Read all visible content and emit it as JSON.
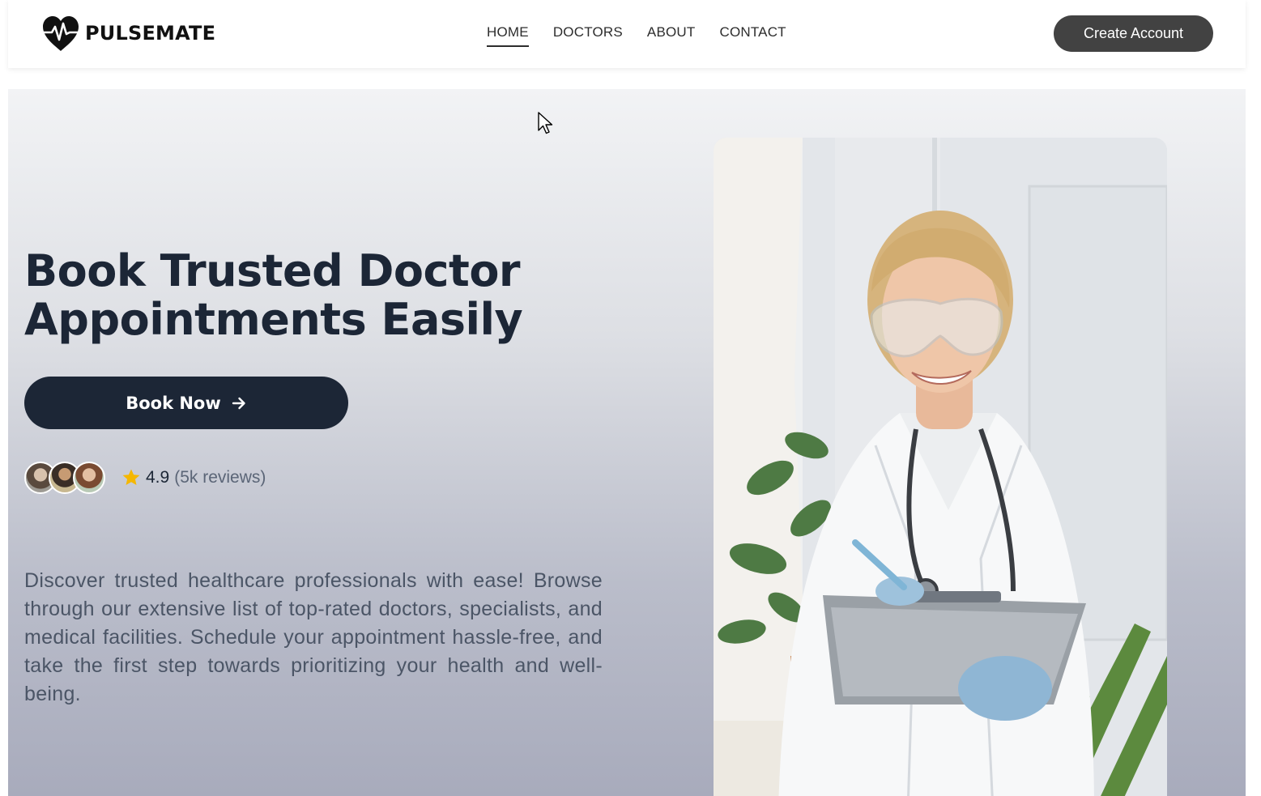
{
  "header": {
    "brand": "PULSEMATE",
    "nav": [
      {
        "label": "HOME",
        "active": true
      },
      {
        "label": "DOCTORS",
        "active": false
      },
      {
        "label": "ABOUT",
        "active": false
      },
      {
        "label": "CONTACT",
        "active": false
      }
    ],
    "create_account_label": "Create Account"
  },
  "hero": {
    "headline_line1": "Book Trusted Doctor",
    "headline_line2": "Appointments Easily",
    "book_button_label": "Book Now",
    "rating_value": "4.9",
    "rating_count": "(5k reviews)",
    "description": "Discover trusted healthcare professionals with ease! Browse through our extensive list of top-rated doctors, specialists, and medical facilities. Schedule your appointment hassle-free, and take the first step towards prioritizing your health and well-being."
  },
  "colors": {
    "primary_dark": "#1c2636",
    "button_gray": "#424242",
    "star": "#f5b700"
  },
  "icons": [
    "heart-pulse-icon",
    "arrow-right-icon",
    "star-icon",
    "cursor-icon"
  ]
}
